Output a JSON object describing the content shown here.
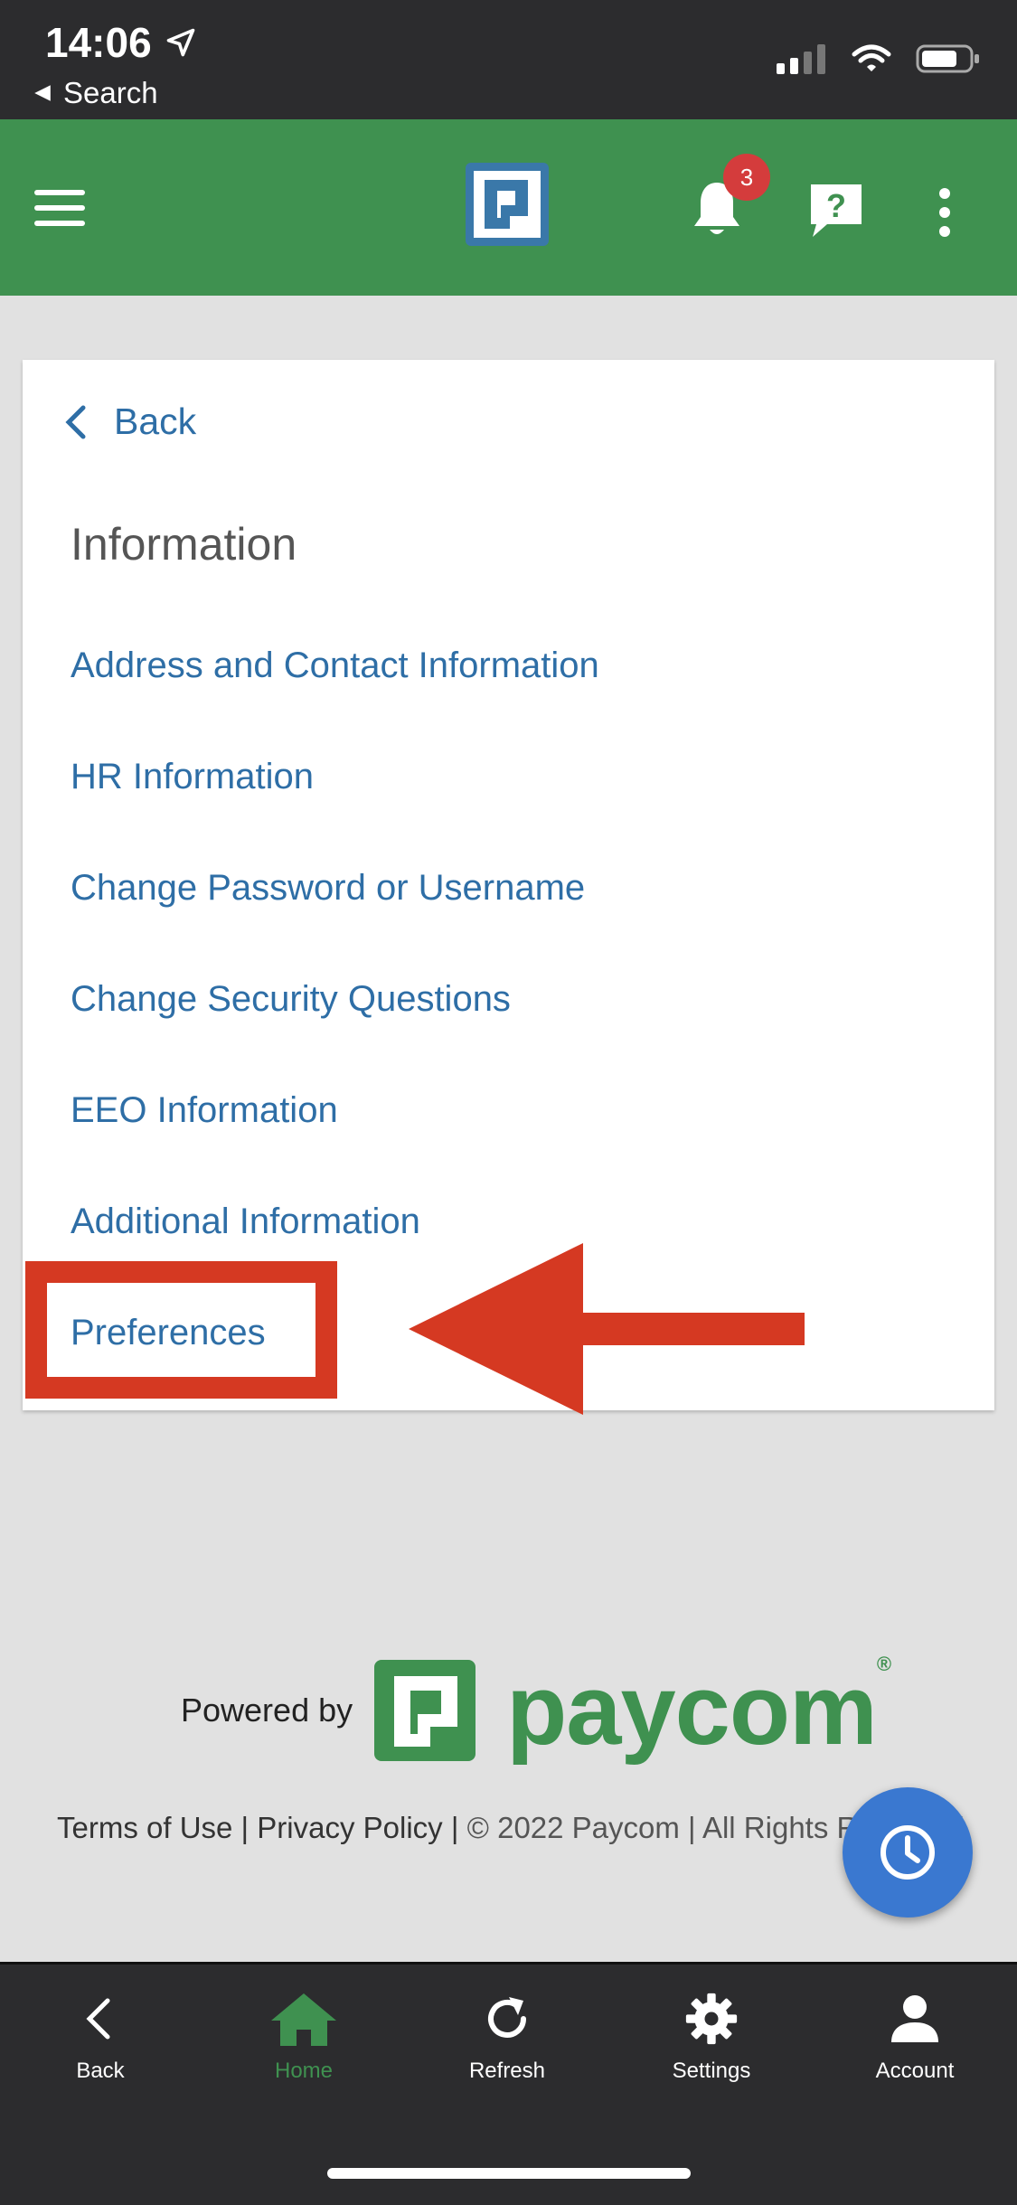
{
  "status_bar": {
    "time": "14:06",
    "back_label": "Search"
  },
  "header": {
    "notification_count": "3"
  },
  "card": {
    "back_label": "Back",
    "title": "Information",
    "items": [
      "Address and Contact Information",
      "HR Information",
      "Change Password or Username",
      "Change Security Questions",
      "EEO Information",
      "Additional Information",
      "Preferences"
    ]
  },
  "branding": {
    "powered_by": "Powered by",
    "wordmark": "paycom",
    "registered": "®"
  },
  "footer": {
    "terms": "Terms of Use",
    "privacy": "Privacy Policy",
    "copyright": "© 2022 Paycom | All Rights Reserved",
    "sep": " | "
  },
  "bottom_nav": {
    "back": "Back",
    "home": "Home",
    "refresh": "Refresh",
    "settings": "Settings",
    "account": "Account"
  },
  "colors": {
    "brand_green": "#3f9150",
    "link_blue": "#2e6ea6",
    "annotation_red": "#d53922"
  }
}
